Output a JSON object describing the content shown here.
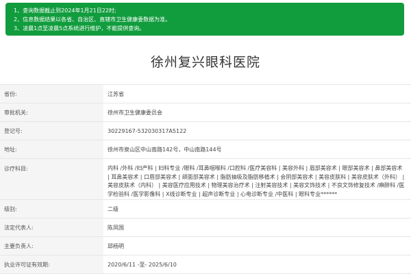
{
  "notice": {
    "lines": [
      "1、查询数据截止到2024年1月21日22时;",
      "2、信息数据结果以各省、自治区、直辖市卫生健康委数据为准。",
      "3、凌晨1点至凌晨5点系统进行维护，不能提供查询。"
    ]
  },
  "hospital": {
    "name": "徐州复兴眼科医院"
  },
  "fields": [
    {
      "label": "省份:",
      "value": "江苏省"
    },
    {
      "label": "审批机关:",
      "value": "徐州市卫生健康委员会"
    },
    {
      "label": "登记号:",
      "value": "30229167-532030317A5122"
    },
    {
      "label": "地址:",
      "value": "徐州市泉山区中山南路142号，中山南路144号"
    },
    {
      "label": "诊疗科目:",
      "value": "内科 /外科 /妇产科 | 妇科专业 /眼科 /耳鼻咽喉科 /口腔科 /医疗美容科 | 美容外科 | 眉部美容术 | 眼部美容术 | 鼻部美容术 | 耳鼻美容术 | 口唇部美容术 | 颌面部美容术 | 脂肪抽吸及脂肪移植术 | 会阴部美容术 | 美容皮肤科 | 美容皮肤术（外科） | 美容皮肤术（内科） | 美容医疗应用技术 | 物理美容治疗术 | 注射美容技术 | 美容文饰技术 | 不良文饰修复技术 /麻醉科 /医学检验科 /医学影像科 | X线诊断专业 | 超声诊断专业 | 心电诊断专业 /中医科 | 眼科专业******"
    },
    {
      "label": "级别:",
      "value": "二级"
    },
    {
      "label": "法定代表人:",
      "value": "陈凤国"
    },
    {
      "label": "主要负责人:",
      "value": "邱杨明"
    },
    {
      "label": "执业许可证有效期:",
      "value": "2020/6/11 -至- 2025/6/10"
    }
  ]
}
